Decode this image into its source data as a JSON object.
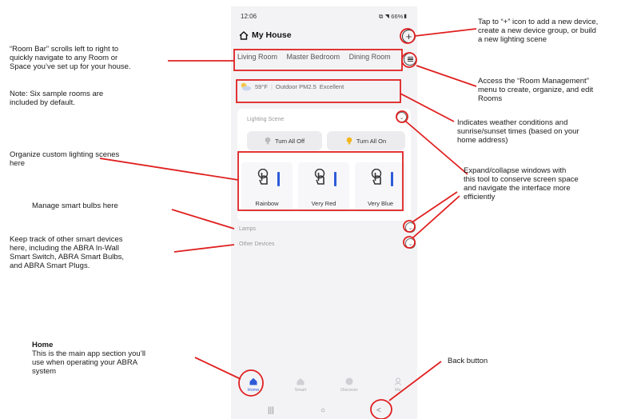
{
  "phone": {
    "status_time": "12:06",
    "status_right": "⧉ ◥ 66%▮",
    "home_title": "My House",
    "rooms": [
      "Living Room",
      "Master Bedroom",
      "Dining Room"
    ],
    "weather": {
      "temp": "59°F",
      "air": "Outdoor PM2.5",
      "quality": "Excellent"
    },
    "lighting_scene_title": "Lighting Scene",
    "turn_all_off": "Turn All Off",
    "turn_all_on": "Turn All On",
    "scenes": [
      {
        "label": "Rainbow"
      },
      {
        "label": "Very Red"
      },
      {
        "label": "Very Blue"
      }
    ],
    "lamps_label": "Lamps",
    "other_devices_label": "Other Devices",
    "nav": [
      {
        "label": "Home",
        "icon": "home-icon",
        "active": true
      },
      {
        "label": "Smart",
        "icon": "smart-icon",
        "active": false
      },
      {
        "label": "Discover",
        "icon": "discover-icon",
        "active": false
      },
      {
        "label": "Me",
        "icon": "profile-icon",
        "active": false
      }
    ],
    "sysnav": {
      "recents": "|||",
      "home": "○",
      "back": "<"
    }
  },
  "annotations": {
    "plus_icon": [
      "Tap to “+” icon to add a new device,",
      "create a new device group, or build",
      "a new lighting scene"
    ],
    "room_bar": [
      "“Room Bar” scrolls left to right to",
      "quickly navigate to any Room or",
      "Space you’ve set up for your house."
    ],
    "note": [
      "Note: Six sample rooms are",
      "included by default."
    ],
    "room_mgmt": [
      "Access the “Room Management”",
      "menu to create, organize, and edit",
      "Rooms"
    ],
    "weather": [
      "Indicates weather conditions and",
      "sunrise/sunset times (based on your",
      "home address)"
    ],
    "scenes": [
      "Organize custom lighting scenes",
      "here"
    ],
    "expand": [
      "Expand/collapse windows with",
      "this tool to conserve screen space",
      "and navigate the interface more",
      "efficiently"
    ],
    "bulbs": [
      "Manage smart bulbs here"
    ],
    "other": [
      "Keep track of other smart devices",
      "here, including the ABRA In-Wall",
      "Smart Switch, ABRA Smart Bulbs,",
      "and ABRA Smart Plugs."
    ],
    "home_title": "Home",
    "home_body": [
      "This is the main app section you’ll",
      "use when operating your ABRA",
      "system"
    ],
    "back": [
      "Back button"
    ]
  },
  "colors": {
    "highlight": "#e02020",
    "accent": "#2d5bd8",
    "background": "#f3f3f6"
  }
}
